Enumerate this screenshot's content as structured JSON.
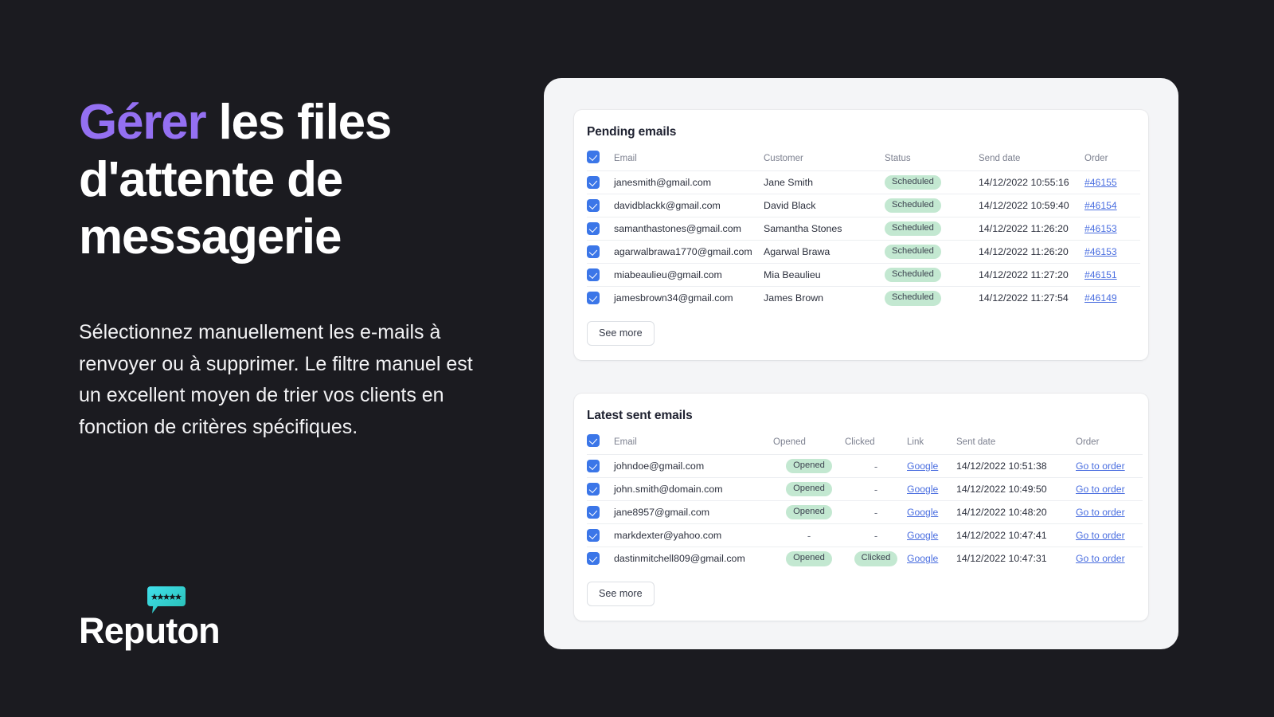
{
  "hero": {
    "headline_accent": "Gérer",
    "headline_rest": " les files d'attente de messagerie",
    "subcopy": "Sélectionnez manuellement les e-mails à renvoyer ou à supprimer. Le filtre manuel est un excellent moyen de trier vos clients en fonction de critères spécifiques.",
    "accent_color": "#9470f2",
    "background_color": "#1b1b20"
  },
  "logo": {
    "wordmark": "Reputon",
    "bubble_icon": "speech-bubble-five-stars-icon",
    "stars": "★★★★★",
    "gradient_from": "#3ddbe8",
    "gradient_to": "#2ec4b6"
  },
  "app": {
    "pending": {
      "title": "Pending emails",
      "columns": [
        "Email",
        "Customer",
        "Status",
        "Send date",
        "Order"
      ],
      "select_all_checked": true,
      "rows": [
        {
          "checked": true,
          "email": "janesmith@gmail.com",
          "customer": "Jane Smith",
          "status": "Scheduled",
          "send_date": "14/12/2022 10:55:16",
          "order": "#46155"
        },
        {
          "checked": true,
          "email": "davidblackk@gmail.com",
          "customer": "David Black",
          "status": "Scheduled",
          "send_date": "14/12/2022 10:59:40",
          "order": "#46154"
        },
        {
          "checked": true,
          "email": "samanthastones@gmail.com",
          "customer": "Samantha Stones",
          "status": "Scheduled",
          "send_date": "14/12/2022 11:26:20",
          "order": "#46153"
        },
        {
          "checked": true,
          "email": "agarwalbrawa1770@gmail.com",
          "customer": "Agarwal Brawa",
          "status": "Scheduled",
          "send_date": "14/12/2022 11:26:20",
          "order": "#46153"
        },
        {
          "checked": true,
          "email": "miabeaulieu@gmail.com",
          "customer": "Mia Beaulieu",
          "status": "Scheduled",
          "send_date": "14/12/2022 11:27:20",
          "order": "#46151"
        },
        {
          "checked": true,
          "email": "jamesbrown34@gmail.com",
          "customer": "James Brown",
          "status": "Scheduled",
          "send_date": "14/12/2022 11:27:54",
          "order": "#46149"
        }
      ],
      "see_more_label": "See more"
    },
    "sent": {
      "title": "Latest sent emails",
      "columns": [
        "Email",
        "Opened",
        "Clicked",
        "Link",
        "Sent date",
        "Order"
      ],
      "select_all_checked": true,
      "rows": [
        {
          "checked": true,
          "email": "johndoe@gmail.com",
          "opened": "Opened",
          "clicked": "-",
          "link": "Google",
          "sent_date": "14/12/2022 10:51:38",
          "order": "Go to order"
        },
        {
          "checked": true,
          "email": "john.smith@domain.com",
          "opened": "Opened",
          "clicked": "-",
          "link": "Google",
          "sent_date": "14/12/2022 10:49:50",
          "order": "Go to order"
        },
        {
          "checked": true,
          "email": "jane8957@gmail.com",
          "opened": "Opened",
          "clicked": "-",
          "link": "Google",
          "sent_date": "14/12/2022 10:48:20",
          "order": "Go to order"
        },
        {
          "checked": true,
          "email": "markdexter@yahoo.com",
          "opened": "-",
          "clicked": "-",
          "link": "Google",
          "sent_date": "14/12/2022 10:47:41",
          "order": "Go to order"
        },
        {
          "checked": true,
          "email": "dastinmitchell809@gmail.com",
          "opened": "Opened",
          "clicked": "Clicked",
          "link": "Google",
          "sent_date": "14/12/2022 10:47:31",
          "order": "Go to order"
        }
      ],
      "see_more_label": "See more"
    },
    "colors": {
      "badge_bg": "#c3e8d1",
      "checkbox": "#3b76e8",
      "link": "#4a6ee0",
      "card_bg": "#ffffff",
      "shell_bg": "#f4f5f7"
    }
  }
}
